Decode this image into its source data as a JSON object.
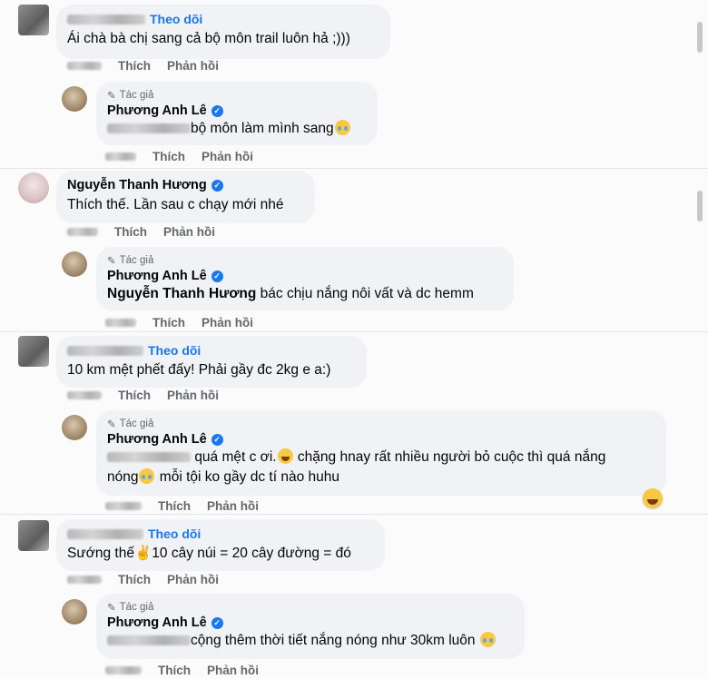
{
  "comments": [
    {
      "follow": "Theo dõi",
      "text": "Ái chà bà chị sang cả bộ môn trail luôn hả ;)))",
      "like": "Thích",
      "reply": "Phản hồi",
      "reply_item": {
        "author_tag": "Tác giả",
        "name": "Phương Anh Lê",
        "text": "bộ môn làm mình sang",
        "like": "Thích",
        "reply": "Phản hồi"
      }
    },
    {
      "name": "Nguyễn Thanh Hương",
      "text": "Thích thế. Lần sau c chạy mới nhé",
      "like": "Thích",
      "reply": "Phản hồi",
      "reply_item": {
        "author_tag": "Tác giả",
        "name": "Phương Anh Lê",
        "mention": "Nguyễn Thanh Hương",
        "text": "bác chịu nắng nôi vất và dc hemm",
        "like": "Thích",
        "reply": "Phản hồi"
      }
    },
    {
      "follow": "Theo dõi",
      "text": "10 km mệt phết đấy! Phải gầy đc 2kg e a:)",
      "like": "Thích",
      "reply": "Phản hồi",
      "reply_item": {
        "author_tag": "Tác giả",
        "name": "Phương Anh Lê",
        "text_a": "quá mệt c ơi.",
        "text_b": "chặng hnay rất nhiều người bỏ cuộc thì quá nắng",
        "text_c": "nóng",
        "text_d": "mỗi tội ko gầy dc tí nào huhu",
        "like": "Thích",
        "reply": "Phản hồi"
      }
    },
    {
      "follow": "Theo dõi",
      "text_a": "Sướng thế",
      "text_b": "10 cây núi = 20 cây đường = đó",
      "like": "Thích",
      "reply": "Phản hồi",
      "reply_item": {
        "author_tag": "Tác giả",
        "name": "Phương Anh Lê",
        "text": "cộng thêm thời tiết nắng nóng như 30km luôn",
        "like": "Thích",
        "reply": "Phản hồi"
      }
    }
  ],
  "colors": {
    "link": "#1877f2",
    "bubble": "#f0f2f5",
    "muted": "#65676b"
  },
  "icons": [
    "pencil-icon",
    "verified-badge-icon",
    "laugh-emoji-icon",
    "teary-emoji-icon",
    "peace-hand-emoji-icon"
  ]
}
